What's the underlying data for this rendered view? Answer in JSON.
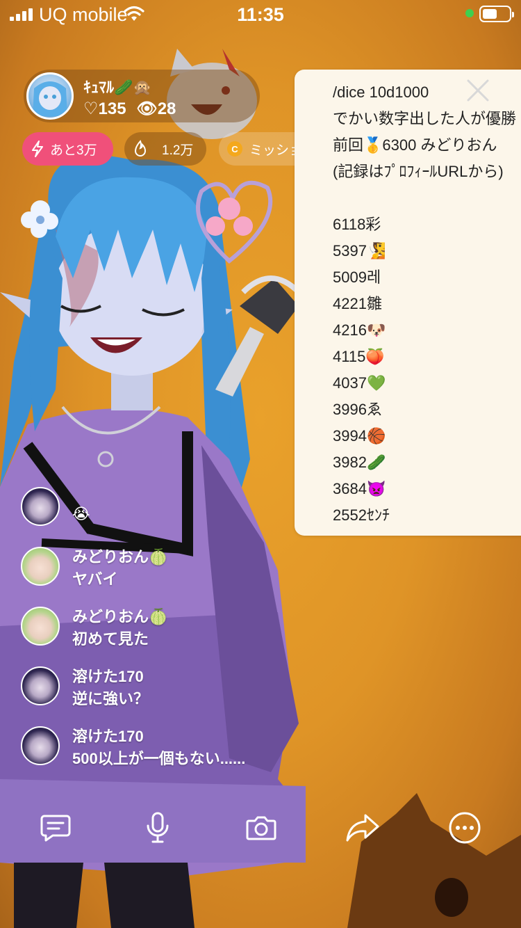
{
  "status_bar": {
    "carrier": "UQ mobile",
    "time": "11:35"
  },
  "host": {
    "name": "ｷｭﾏﾙ🥒🙊",
    "hearts": "♡135",
    "viewers": "👁28"
  },
  "pills": {
    "goal": "あと3万",
    "fire": "1.2万",
    "mission": "ミッション"
  },
  "panel": {
    "lines": [
      "/dice 10d1000",
      "でかい数字出した人が優勝",
      "前回🥇6300 みどりおん",
      "(記録はﾌﾟﾛﾌｨｰﾙURLから)",
      "",
      "6118彩",
      "5397🧏",
      "5009레",
      "4221雛",
      "4216🐶",
      "4115🍑",
      "4037💚",
      "3996ゑ",
      "3994🏀",
      "3982🥒",
      "3684👿",
      "2552ｾﾝﾁ"
    ]
  },
  "comments": [
    {
      "name": "",
      "text": "😭"
    },
    {
      "name": "みどりおん🍈",
      "text": "ヤバイ"
    },
    {
      "name": "みどりおん🍈",
      "text": "初めて見た"
    },
    {
      "name": "溶けた170",
      "text": "逆に強い？"
    },
    {
      "name": "溶けた170",
      "text": "500以上が一個もない......"
    }
  ],
  "colors": {
    "background": "#e09a2a",
    "goal_pill": "#f0507a",
    "panel": "#fcf6ea",
    "status_dot": "#3fd04f"
  },
  "toolbar_icons": [
    "comment-icon",
    "microphone-icon",
    "camera-icon",
    "share-icon",
    "more-icon"
  ]
}
